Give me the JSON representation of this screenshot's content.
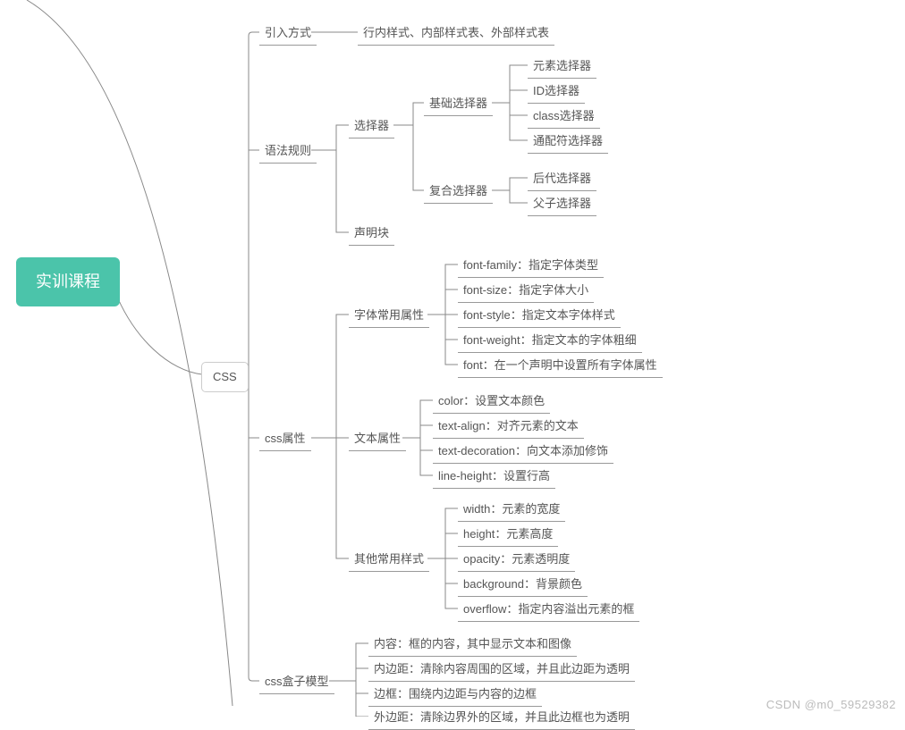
{
  "root": {
    "label": "实训课程"
  },
  "css_node": {
    "label": "CSS"
  },
  "level1": {
    "import": "引入方式",
    "syntax": "语法规则",
    "props": "css属性",
    "box": "css盒子模型"
  },
  "import_detail": "行内样式、内部样式表、外部样式表",
  "syntax": {
    "selector": "选择器",
    "declare": "声明块",
    "basic": "基础选择器",
    "compound": "复合选择器",
    "basic_items": {
      "element": "元素选择器",
      "id": "ID选择器",
      "class": "class选择器",
      "wildcard": "通配符选择器"
    },
    "compound_items": {
      "descendant": "后代选择器",
      "child": "父子选择器"
    }
  },
  "props": {
    "font": "字体常用属性",
    "text": "文本属性",
    "other": "其他常用样式",
    "font_items": {
      "family": "font-family：指定字体类型",
      "size": "font-size：指定字体大小",
      "style": "font-style：指定文本字体样式",
      "weight": "font-weight：指定文本的字体粗细",
      "font": "font：在一个声明中设置所有字体属性"
    },
    "text_items": {
      "color": "color：设置文本颜色",
      "align": "text-align：对齐元素的文本",
      "decoration": "text-decoration：向文本添加修饰",
      "lineheight": "line-height：设置行高"
    },
    "other_items": {
      "width": "width：元素的宽度",
      "height": "height：元素高度",
      "opacity": "opacity：元素透明度",
      "background": "background：背景颜色",
      "overflow": "overflow：指定内容溢出元素的框"
    }
  },
  "box_items": {
    "content": "内容：框的内容，其中显示文本和图像",
    "padding": "内边距：清除内容周围的区域，并且此边距为透明",
    "border": "边框：围绕内边距与内容的边框",
    "margin": "外边距：清除边界外的区域，并且此边框也为透明"
  },
  "watermark": "CSDN @m0_59529382"
}
